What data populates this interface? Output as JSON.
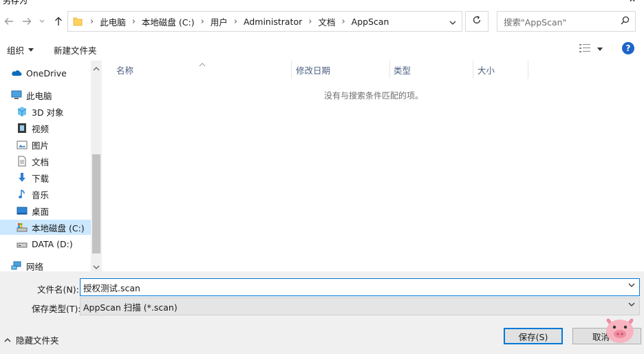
{
  "window": {
    "title": "另存为",
    "close_glyph": "✕"
  },
  "address": {
    "segments": [
      "此电脑",
      "本地磁盘 (C:)",
      "用户",
      "Administrator",
      "文档",
      "AppScan"
    ]
  },
  "search": {
    "placeholder": "搜索\"AppScan\""
  },
  "toolbar": {
    "organize": "组织",
    "new_folder": "新建文件夹"
  },
  "nav": {
    "items": [
      {
        "label": "OneDrive",
        "icon": "onedrive-cloud-icon"
      },
      {
        "label": "此电脑",
        "icon": "this-pc-icon"
      },
      {
        "label": "3D 对象",
        "icon": "3d-objects-icon"
      },
      {
        "label": "视频",
        "icon": "videos-icon"
      },
      {
        "label": "图片",
        "icon": "pictures-icon"
      },
      {
        "label": "文档",
        "icon": "documents-icon"
      },
      {
        "label": "下载",
        "icon": "downloads-icon"
      },
      {
        "label": "音乐",
        "icon": "music-icon"
      },
      {
        "label": "桌面",
        "icon": "desktop-icon"
      },
      {
        "label": "本地磁盘 (C:)",
        "icon": "local-disk-icon",
        "selected": true
      },
      {
        "label": "DATA (D:)",
        "icon": "drive-icon"
      },
      {
        "label": "网络",
        "icon": "network-icon"
      }
    ]
  },
  "list": {
    "columns": [
      "名称",
      "修改日期",
      "类型",
      "大小"
    ],
    "empty_message": "没有与搜索条件匹配的项。"
  },
  "bottom": {
    "filename_label": "文件名(N):",
    "filename_value": "授权测试.scan",
    "filetype_label": "保存类型(T):",
    "filetype_value": "AppScan 扫描 (*.scan)",
    "hide_folders": "隐藏文件夹",
    "save": "保存(S)",
    "cancel": "取消"
  },
  "colors": {
    "accent": "#0078d7",
    "selection": "#cce8ff",
    "help": "#1e64c8"
  }
}
